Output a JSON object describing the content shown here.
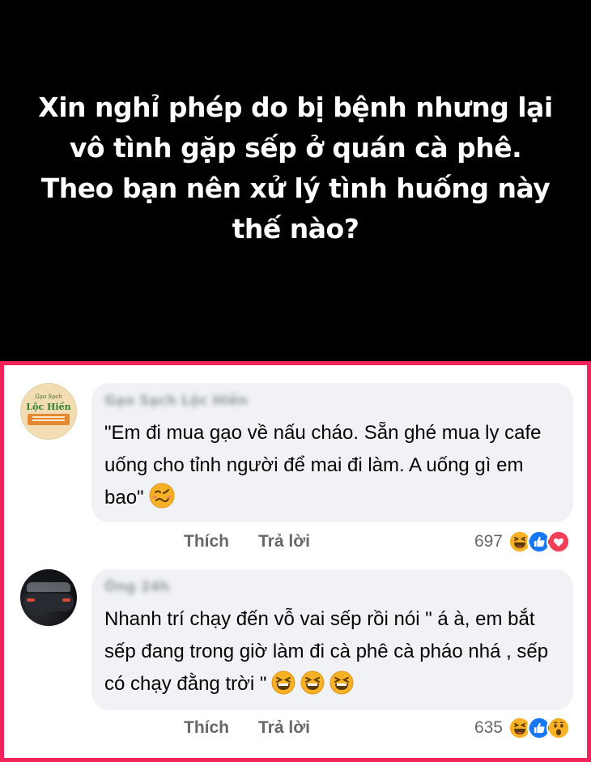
{
  "banner": {
    "title": "Xin nghỉ phép do bị bệnh nhưng lại vô tình gặp sếp ở quán cà phê. Theo bạn nên xử lý tình huống này thế nào?"
  },
  "comments": [
    {
      "author": "Gạo Sạch Lộc Hiền",
      "avatar_text": {
        "small": "Gạo Sạch",
        "big": "Lộc Hiền"
      },
      "text": "\"Em đi mua gạo về nấu cháo. Sẵn ghé mua ly cafe uống cho tỉnh người để mai đi làm. A uống gì em bao\"",
      "inline_emojis": [
        "woozy-face-icon"
      ],
      "like_label": "Thích",
      "reply_label": "Trả lời",
      "reaction_count": "697",
      "reactions": [
        "haha-icon",
        "like-icon",
        "love-icon"
      ]
    },
    {
      "author": "Ông 24h",
      "text": "Nhanh trí chạy đến vỗ vai sếp rồi nói \" á à, em bắt sếp đang trong giờ làm đi cà phê cà pháo nhá , sếp có chạy đằng trời \"",
      "inline_emojis": [
        "laughing-face-icon",
        "laughing-face-icon",
        "laughing-face-icon"
      ],
      "like_label": "Thích",
      "reply_label": "Trả lời",
      "reaction_count": "635",
      "reactions": [
        "haha-icon",
        "like-icon",
        "wow-icon"
      ]
    }
  ],
  "colors": {
    "frame_border": "#f0245a",
    "bubble_bg": "#f0f2f5",
    "secondary_text": "#65676b",
    "like_blue": "#1877f2",
    "love_red": "#f33e58",
    "emoji_yellow": "#f7b125"
  }
}
